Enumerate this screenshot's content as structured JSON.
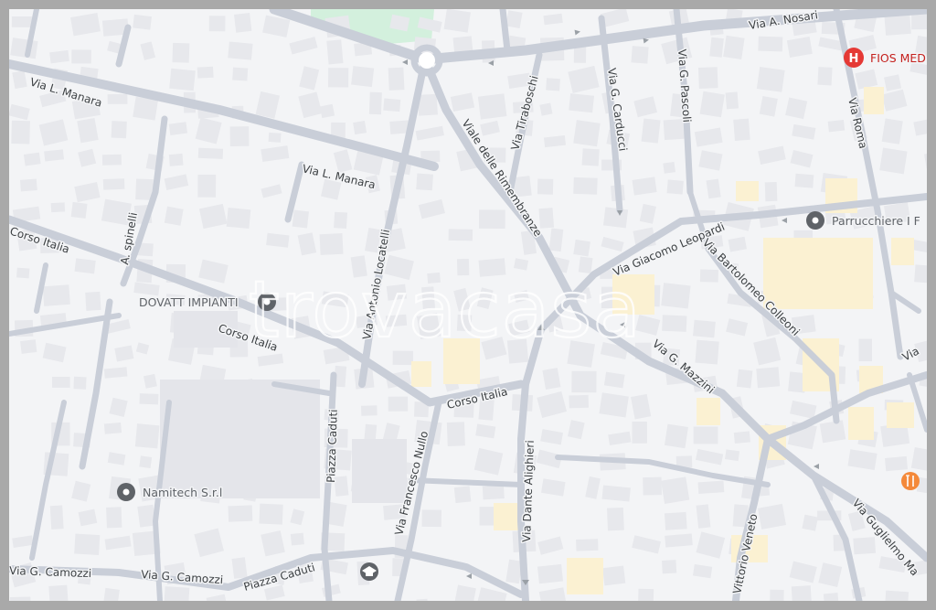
{
  "watermark": "trovacasa",
  "colors": {
    "background": "#f3f4f6",
    "frame": "#a9a9a9",
    "road": "#c9ced8",
    "park": "#d3f0dd",
    "poi_marker": "#5f6368",
    "hospital": "#e53935",
    "restaurant": "#f4893a"
  },
  "streets": [
    {
      "id": "via-a-nosari",
      "label": "Via A. Nosari"
    },
    {
      "id": "via-l-manara-1",
      "label": "Via L. Manara"
    },
    {
      "id": "via-l-manara-2",
      "label": "Via L. Manara"
    },
    {
      "id": "via-tiraboschi",
      "label": "Via Tiraboschi"
    },
    {
      "id": "via-g-carducci",
      "label": "Via G. Carducci"
    },
    {
      "id": "via-g-pascoli",
      "label": "Via G. Pascoli"
    },
    {
      "id": "via-roma",
      "label": "Via Roma"
    },
    {
      "id": "viale-delle-rimembranze",
      "label": "Viale delle Rimembranze"
    },
    {
      "id": "a-spinelli",
      "label": "A. spinelli"
    },
    {
      "id": "corso-italia-1",
      "label": "Corso Italia"
    },
    {
      "id": "corso-italia-2",
      "label": "Corso Italia"
    },
    {
      "id": "corso-italia-3",
      "label": "Corso Italia"
    },
    {
      "id": "via-antonio-locatelli",
      "label": "Via Antonio Locatelli"
    },
    {
      "id": "via-giacomo-leopardi",
      "label": "Via Giacomo Leopardi"
    },
    {
      "id": "via-bartolomeo-colleoni",
      "label": "Via Bartolomeo Colleoni"
    },
    {
      "id": "via-g-mazzini",
      "label": "Via G. Mazzini"
    },
    {
      "id": "piazza-caduti-1",
      "label": "Piazza Caduti"
    },
    {
      "id": "piazza-caduti-2",
      "label": "Piazza Caduti"
    },
    {
      "id": "via-francesco-nullo",
      "label": "Via Francesco Nullo"
    },
    {
      "id": "via-dante-alighieri",
      "label": "Via Dante Alighieri"
    },
    {
      "id": "vittorio-veneto",
      "label": "Vittorio Veneto"
    },
    {
      "id": "via-guglielmo",
      "label": "Via Guglielmo Ma"
    },
    {
      "id": "via-g-camozzi-1",
      "label": "Via G. Camozzi"
    },
    {
      "id": "via-g-camozzi-2",
      "label": "Via G. Camozzi"
    },
    {
      "id": "via-edge",
      "label": "Via"
    }
  ],
  "pois": [
    {
      "id": "dovatt",
      "label": "DOVATT IMPIANTI",
      "icon": "place-pin-icon"
    },
    {
      "id": "parrucchiere",
      "label": "Parrucchiere I F",
      "icon": "place-pin-icon"
    },
    {
      "id": "namitech",
      "label": "Namitech S.r.l",
      "icon": "place-pin-icon"
    },
    {
      "id": "fios",
      "label": "FIOS MED",
      "icon": "hospital-icon"
    },
    {
      "id": "school",
      "label": "",
      "icon": "school-icon"
    },
    {
      "id": "restaurant",
      "label": "",
      "icon": "restaurant-icon"
    }
  ]
}
